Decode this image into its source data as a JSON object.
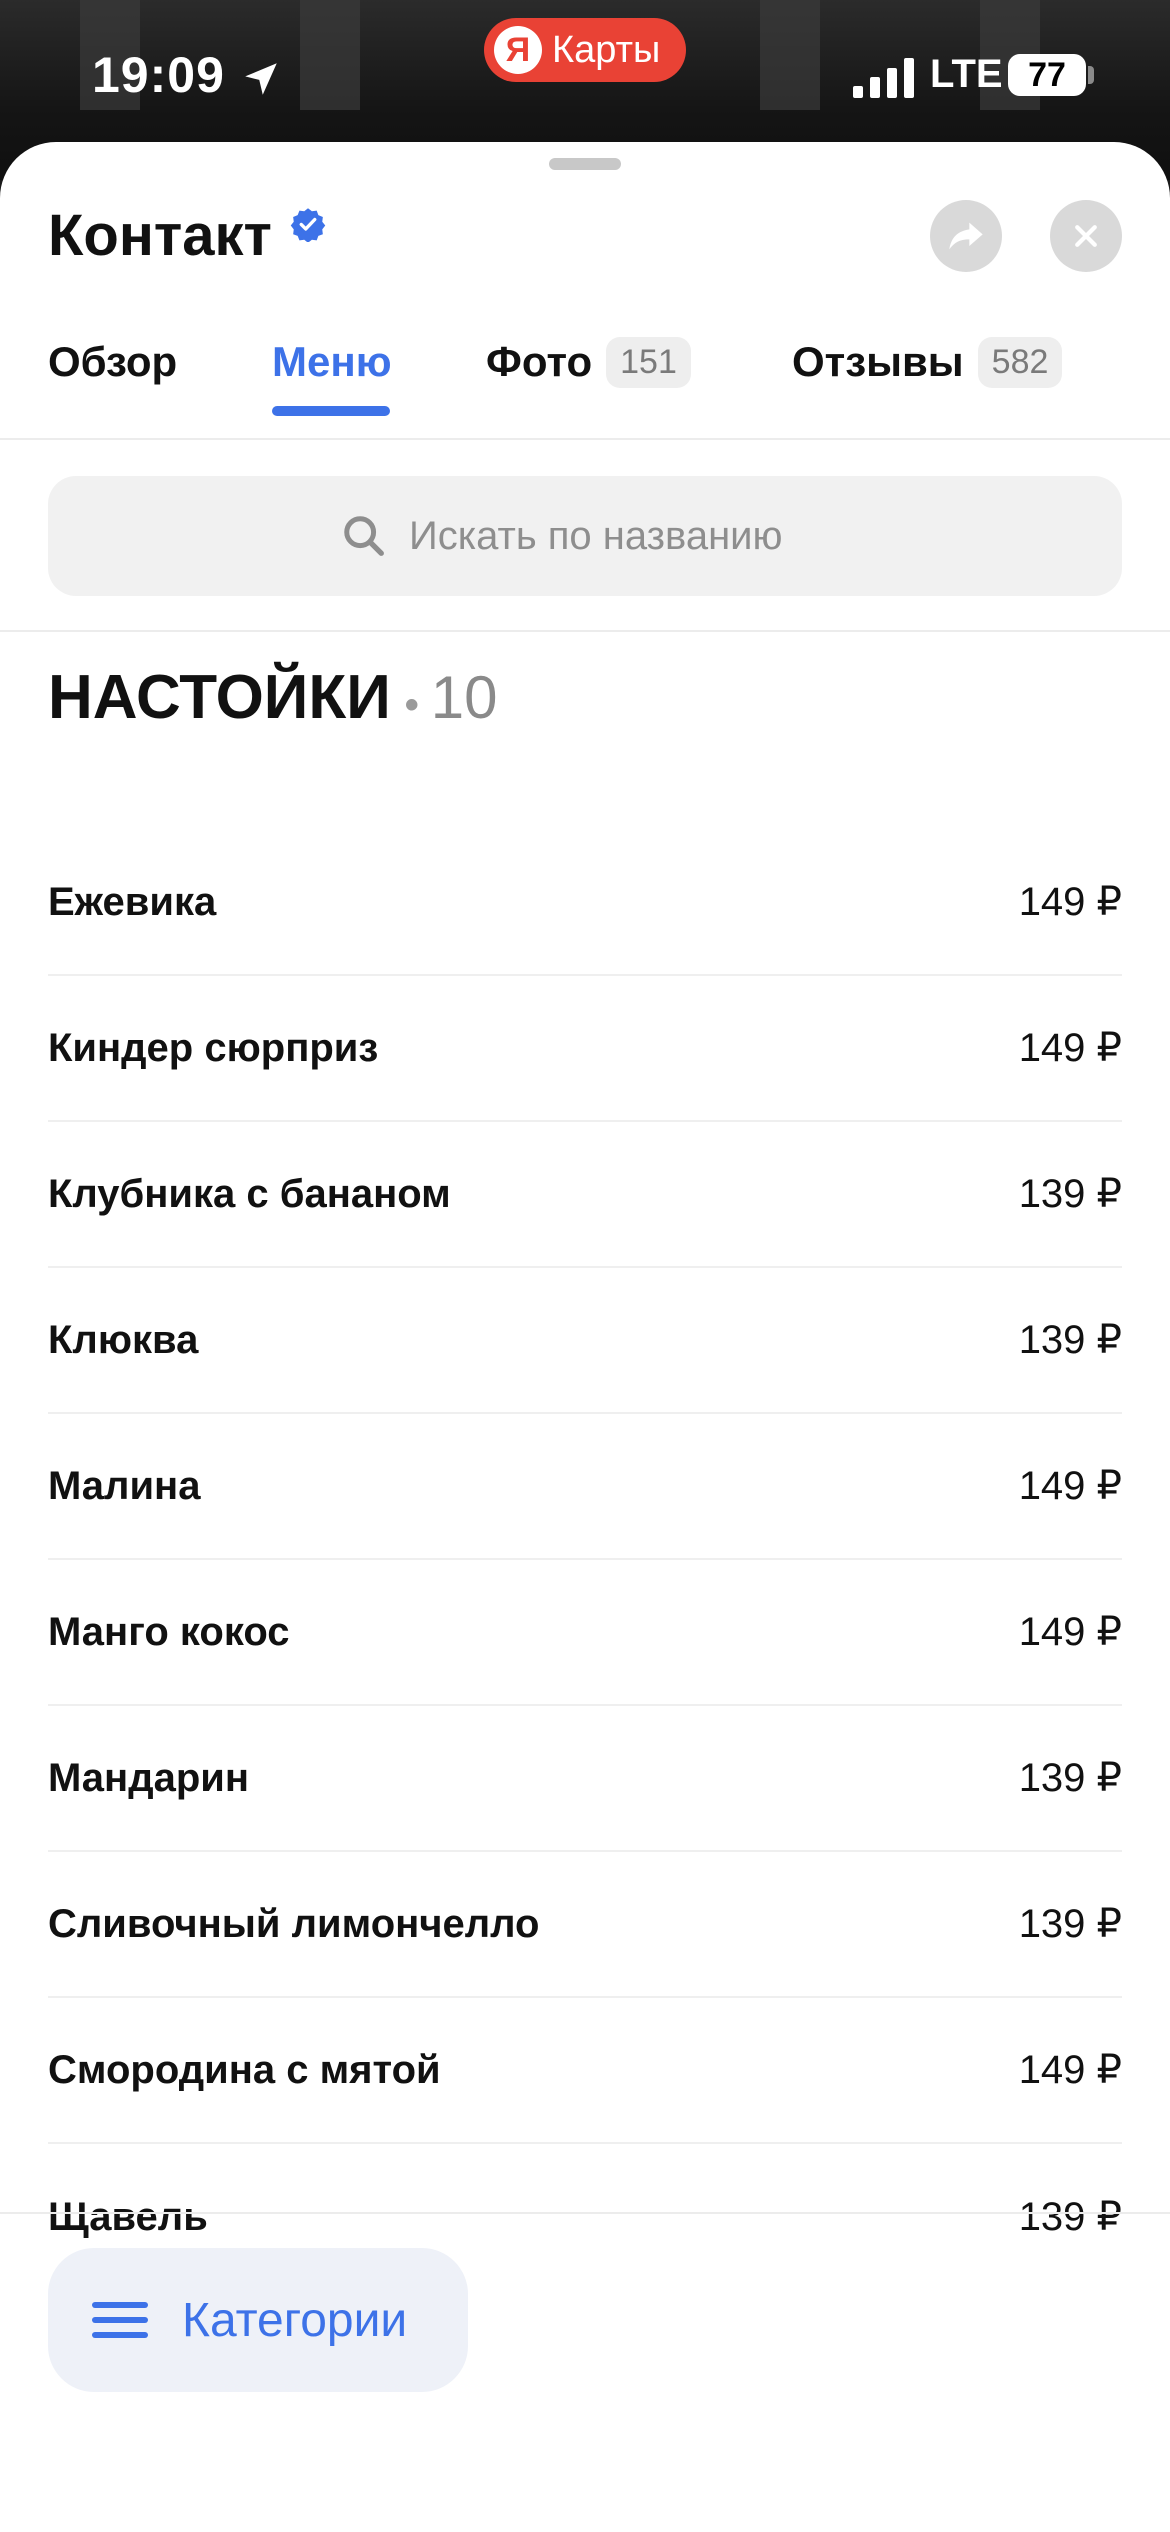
{
  "status_bar": {
    "time": "19:09",
    "app_badge_letter": "Я",
    "app_name": "Карты",
    "network": "LTE",
    "battery": "77"
  },
  "place": {
    "title": "Контакт"
  },
  "tabs": [
    {
      "label": "Обзор"
    },
    {
      "label": "Меню",
      "active": true
    },
    {
      "label": "Фото",
      "badge": "151"
    },
    {
      "label": "Отзывы",
      "badge": "582"
    }
  ],
  "search": {
    "placeholder": "Искать по названию"
  },
  "section": {
    "title": "НАСТОЙКИ",
    "separator": "•",
    "count": "10"
  },
  "menu_items": [
    {
      "name": "Ежевика",
      "price": "149 ₽"
    },
    {
      "name": "Киндер сюрприз",
      "price": "149 ₽"
    },
    {
      "name": "Клубника с бананом",
      "price": "139 ₽"
    },
    {
      "name": "Клюква",
      "price": "139 ₽"
    },
    {
      "name": "Малина",
      "price": "149 ₽"
    },
    {
      "name": "Манго кокос",
      "price": "149 ₽"
    },
    {
      "name": "Мандарин",
      "price": "139 ₽"
    },
    {
      "name": "Сливочный лимончелло",
      "price": "139 ₽"
    },
    {
      "name": "Смородина с мятой",
      "price": "149 ₽"
    },
    {
      "name": "Щавель",
      "price": "139 ₽"
    }
  ],
  "categories_button": {
    "label": "Категории"
  },
  "colors": {
    "accent": "#3d72e8",
    "brand_red": "#e94235"
  },
  "icons": [
    "location-arrow-icon",
    "signal-icon",
    "battery-icon",
    "verified-icon",
    "share-icon",
    "close-icon",
    "search-icon",
    "menu-burger-icon"
  ]
}
